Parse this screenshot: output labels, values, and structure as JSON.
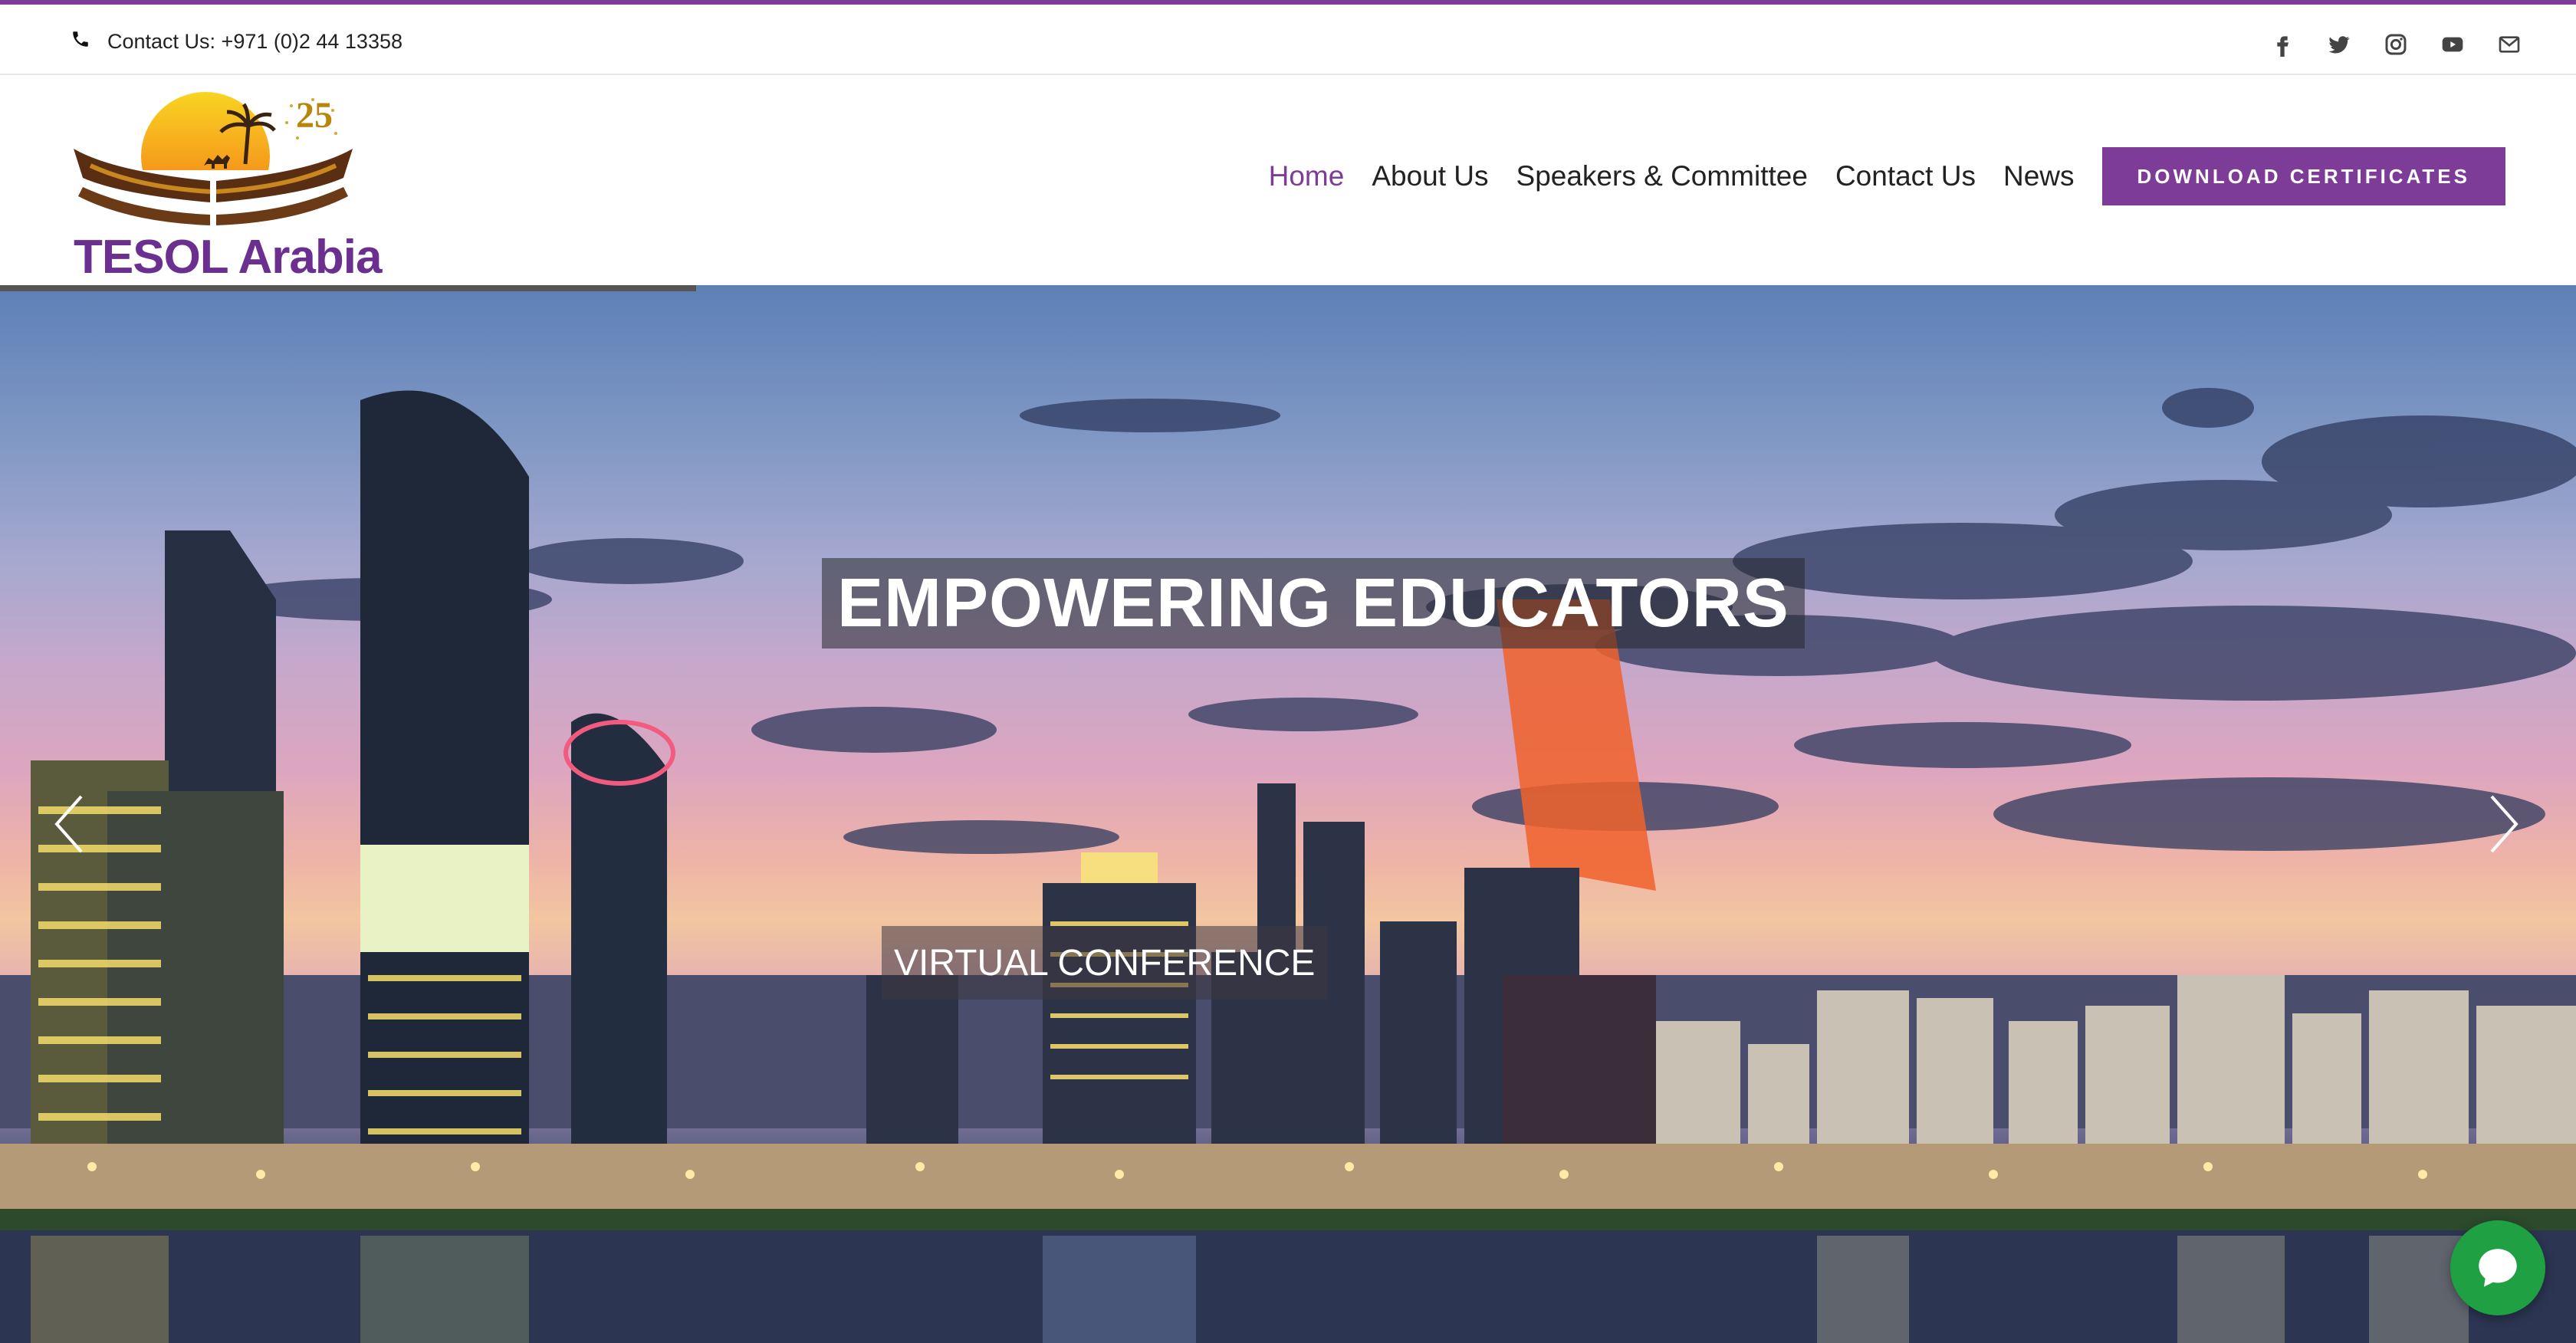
{
  "topbar": {
    "contact_text": "Contact Us: +971 (0)2 44 13358",
    "social_icons": [
      "facebook-icon",
      "twitter-icon",
      "instagram-icon",
      "youtube-icon",
      "email-icon"
    ]
  },
  "brand": {
    "name": "TESOL Arabia",
    "anniversary": "25",
    "primary_color": "#7d3c98"
  },
  "nav": {
    "items": [
      {
        "label": "Home",
        "active": true
      },
      {
        "label": "About Us",
        "active": false
      },
      {
        "label": "Speakers & Committee",
        "active": false
      },
      {
        "label": "Contact Us",
        "active": false
      },
      {
        "label": "News",
        "active": false
      }
    ],
    "cta_label": "DOWNLOAD CERTIFICATES"
  },
  "hero": {
    "headline": "EMPOWERING EDUCATORS",
    "subline": "VIRTUAL CONFERENCE"
  },
  "chat": {
    "icon": "chat-icon",
    "color": "#1fa043"
  }
}
